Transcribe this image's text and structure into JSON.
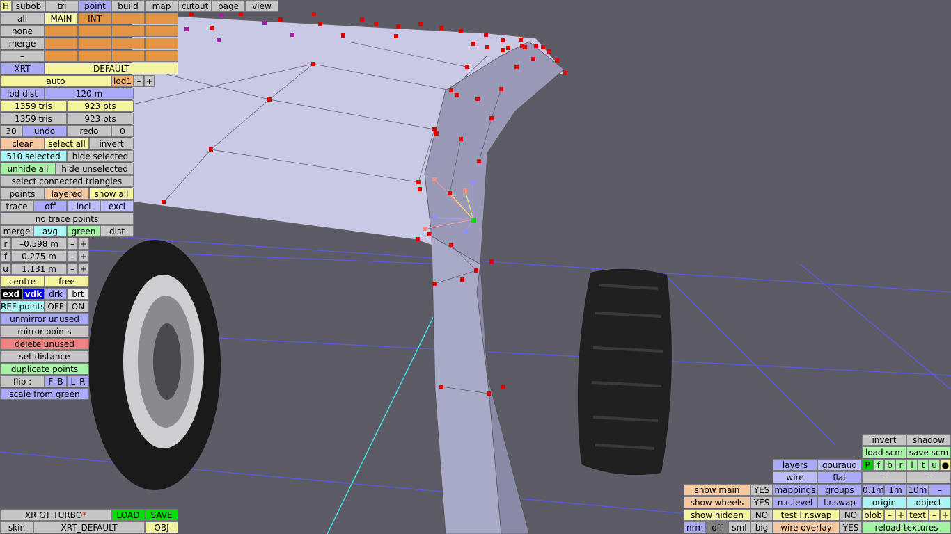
{
  "top_tabs": [
    "H",
    "subob",
    "tri",
    "point",
    "build",
    "map",
    "cutout",
    "page",
    "view"
  ],
  "layer_row": {
    "all": "all",
    "main": "MAIN",
    "int": "INT"
  },
  "side_labels": [
    "none",
    "merge",
    "–"
  ],
  "xrt": {
    "label": "XRT",
    "default": "DEFAULT"
  },
  "lod": {
    "auto": "auto",
    "lod": "lod1",
    "minus": "–",
    "plus": "+",
    "dist_label": "lod dist",
    "dist_value": "120 m"
  },
  "stats": [
    {
      "tris": "1359 tris",
      "pts": "923 pts"
    },
    {
      "tris": "1359 tris",
      "pts": "923 pts"
    }
  ],
  "undo_row": {
    "count": "30",
    "undo": "undo",
    "redo": "redo",
    "redo_count": "0"
  },
  "select_row": {
    "clear": "clear",
    "select_all": "select all",
    "invert": "invert"
  },
  "selected_row": {
    "selected": "510 selected",
    "hide_selected": "hide selected"
  },
  "unhide_row": {
    "unhide_all": "unhide all",
    "hide_unselected": "hide unselected"
  },
  "select_connected": "select connected triangles",
  "points_row": {
    "points": "points",
    "layered": "layered",
    "show_all": "show all"
  },
  "trace_row": {
    "trace": "trace",
    "off": "off",
    "incl": "incl",
    "excl": "excl"
  },
  "no_trace": "no trace points",
  "merge_row": {
    "merge": "merge",
    "avg": "avg",
    "green": "green",
    "dist": "dist"
  },
  "coords": [
    {
      "axis": "r",
      "value": "–0.598 m"
    },
    {
      "axis": "f",
      "value": "0.275 m"
    },
    {
      "axis": "u",
      "value": "1.131 m"
    }
  ],
  "centre_row": {
    "centre": "centre",
    "free": "free"
  },
  "render_row": {
    "exd": "exd",
    "vdk": "vdk",
    "drk": "drk",
    "brt": "brt"
  },
  "ref_row": {
    "label": "REF points",
    "off": "OFF",
    "on": "ON"
  },
  "actions": [
    "unmirror unused",
    "mirror points",
    "delete unused",
    "set distance",
    "duplicate points"
  ],
  "flip_row": {
    "label": "flip :",
    "fb": "F–B",
    "lr": "L–R"
  },
  "scale_green": "scale from green",
  "bottom_left": {
    "car": "XR GT TURBO",
    "star": "*",
    "load": "LOAD",
    "save": "SAVE",
    "skin": "skin",
    "skin_name": "XRT_DEFAULT",
    "obj": "OBJ"
  },
  "right_panel": {
    "invert": "invert",
    "shadow": "shadow",
    "load_scm": "load scm",
    "save_scm": "save scm",
    "letters": [
      "P",
      "f",
      "b",
      "r",
      "l",
      "t",
      "u",
      "●"
    ],
    "layers": "layers",
    "gouraud": "gouraud",
    "wire": "wire",
    "flat": "flat",
    "dash": "–",
    "show_main": "show main",
    "show_main_val": "YES",
    "mappings": "mappings",
    "groups": "groups",
    "d01": "0.1m",
    "d1": "1m",
    "d10": "10m",
    "show_wheels": "show wheels",
    "show_wheels_val": "YES",
    "nc_level": "n.c.level",
    "lr_swap": "l.r.swap",
    "origin": "origin",
    "object": "object",
    "show_hidden": "show hidden",
    "show_hidden_val": "NO",
    "test_lr_swap": "test l.r.swap",
    "test_val": "NO",
    "blob": "blob",
    "text": "text",
    "plus": "+",
    "nrm": "nrm",
    "off": "off",
    "sml": "sml",
    "big": "big",
    "wire_overlay": "wire overlay",
    "wire_overlay_val": "YES",
    "reload_textures": "reload textures"
  },
  "colors": {
    "background": "#5d5c66",
    "mesh": "#c9c9e6",
    "point_red": "#ff0000",
    "point_green": "#00e000"
  }
}
